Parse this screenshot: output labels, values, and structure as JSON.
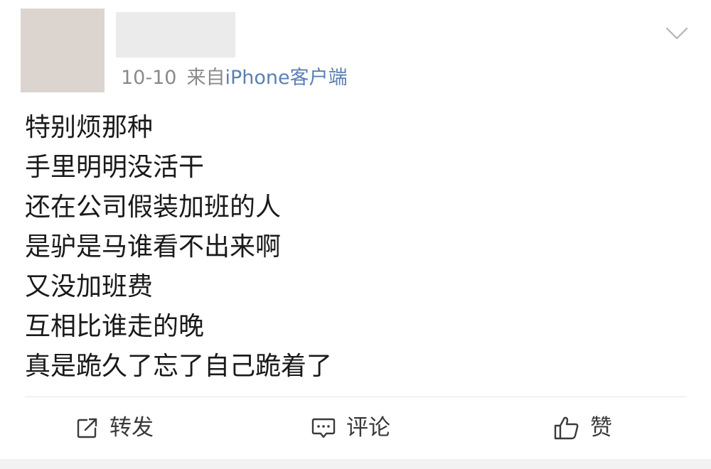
{
  "post": {
    "date": "10-10",
    "source_prefix": "来自",
    "source_client": "iPhone客户端",
    "content_lines": [
      "特别烦那种",
      "手里明明没活干",
      "还在公司假装加班的人",
      "是驴是马谁看不出来啊",
      "又没加班费",
      "互相比谁走的晚",
      "真是跪久了忘了自己跪着了"
    ]
  },
  "actions": {
    "repost_label": "转发",
    "comment_label": "评论",
    "like_label": "赞"
  },
  "icons": {
    "menu": "chevron-down-icon",
    "repost": "repost-icon",
    "comment": "comment-icon",
    "like": "thumbs-up-icon"
  },
  "colors": {
    "link": "#5b7fb3",
    "meta": "#8a8a8a",
    "text": "#1a1a1a",
    "avatar_placeholder": "#dcd4ce",
    "name_placeholder": "#ebebeb"
  }
}
